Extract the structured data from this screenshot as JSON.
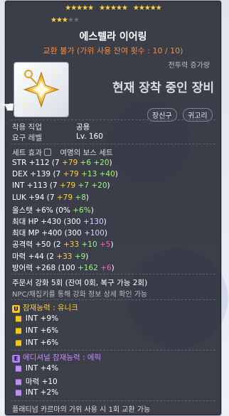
{
  "stars": {
    "row1_filled": 15,
    "row2_filled": 3,
    "row2_empty": 2
  },
  "item": {
    "name": "에스텔라 이어링",
    "trade_note": "교환 불가 (가위 사용 잔여 횟수 : 10 / 10)",
    "combat_power_label": "전투력 증가량",
    "equipped_text": "현재 장착 중인 장비",
    "categories": [
      "장신구",
      "귀고리"
    ],
    "job_label": "착용 직업",
    "job_value": "공용",
    "level_label": "요구 레벨",
    "level_value": "Lv. 160"
  },
  "set": {
    "label": "세트 효과",
    "name": "여명의 보스 세트"
  },
  "stats": [
    {
      "name": "STR",
      "total": "+112",
      "base": "7",
      "a": "+79",
      "b": "+6",
      "c": "+20"
    },
    {
      "name": "DEX",
      "total": "+139",
      "base": "7",
      "a": "+79",
      "b": "+13",
      "c": "+40"
    },
    {
      "name": "INT",
      "total": "+113",
      "base": "7",
      "a": "+79",
      "b": "+7",
      "c": "+20"
    },
    {
      "name": "LUK",
      "total": "+94",
      "base": "7",
      "a": "+79",
      "b": "+8",
      "c": ""
    },
    {
      "name": "올스탯",
      "total": "+6%",
      "base": "0%",
      "a": "",
      "b": "+6%",
      "c": ""
    },
    {
      "name": "최대 HP",
      "total": "+430",
      "base": "300",
      "a": "",
      "b": "+130",
      "c": ""
    },
    {
      "name": "최대 MP",
      "total": "+400",
      "base": "300",
      "a": "",
      "b": "+100",
      "c": ""
    },
    {
      "name": "공격력",
      "total": "+50",
      "base": "2",
      "a": "+33",
      "b": "+10",
      "c": "+5"
    },
    {
      "name": "마력",
      "total": "+44",
      "base": "2",
      "a": "+33",
      "b": "+9",
      "c": ""
    },
    {
      "name": "방어력",
      "total": "+268",
      "base": "100",
      "a": "",
      "b": "+162",
      "c": "+6"
    }
  ],
  "enhance": {
    "line": "주문서 강화 5회 (잔여 0회, 복구 가능 2회)",
    "note": "NPC/채집키를 통해 강화 정보 상세 확인 가능"
  },
  "potential": {
    "title": "잠재능력 : 유니크",
    "lines": [
      "INT +9%",
      "INT +6%",
      "INT +6%"
    ]
  },
  "additional": {
    "title": "에디셔널 잠재능력 : 에픽",
    "lines": [
      "INT +4%",
      "마력 +10",
      "INT +2%"
    ]
  },
  "footer": "플래티넘 카르마의 가위 사용 시 1회 교환 가능"
}
